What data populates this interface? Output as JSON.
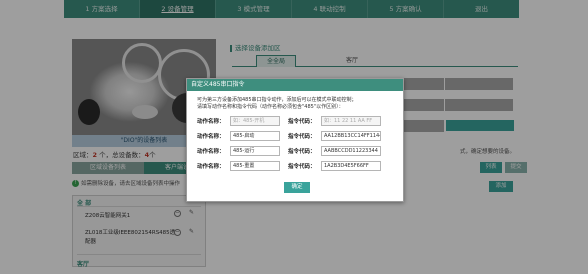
{
  "nav": {
    "items": [
      {
        "label": "1 方案选择",
        "active": false
      },
      {
        "label": "2 设备管理",
        "active": true
      },
      {
        "label": "3 模式管理",
        "active": false
      },
      {
        "label": "4 联动控制",
        "active": false
      },
      {
        "label": "5 方案确认",
        "active": false
      },
      {
        "label": "退出",
        "active": false
      }
    ]
  },
  "left": {
    "photo_caption": "\"DIO\"的设备列表",
    "region": {
      "label_prefix": "区域：",
      "region_count": "2",
      "sep": "  个，总设备数：",
      "device_count": "4",
      "suffix": "个"
    },
    "tabs": [
      "区域设备列表",
      "客户端设备"
    ],
    "hint": "如需删除设备，请去区域设备列表中操作",
    "devices": {
      "group1": "全 部",
      "item1": "Z208云智能网关1",
      "item2": "ZL018工业级IEEE802154RS485透",
      "item2_line2": "配器",
      "group2": "客厅"
    }
  },
  "right": {
    "title": "选择设备添加区",
    "tabs": [
      "全全局",
      "客厅"
    ],
    "note": "式，确定想要的设备。",
    "buttons": {
      "list": "列表",
      "submit": "提交",
      "add": "添加"
    }
  },
  "modal": {
    "title": "自定义485串口指令",
    "desc_line1": "可为第三方设备添加485串口指令动作，添加后可以在模式中联动控制；",
    "desc_line2": "请填写动作名称和指令代码（动作名称必须包含\"485\"以作区别）：",
    "label_action": "动作名称：",
    "label_code": "指令代码：",
    "rows": [
      {
        "action": "",
        "action_placeholder": "如：485-开机",
        "code": "",
        "code_placeholder": "如：11 22 11 AA FF"
      },
      {
        "action": "485-启动",
        "code": "AA12BB13CC14FF11443"
      },
      {
        "action": "485-运行",
        "code": "AABBCCDD11223344"
      },
      {
        "action": "485-重置",
        "code": "1A2B3D4E5F66FF"
      }
    ],
    "ok_label": "确定"
  }
}
